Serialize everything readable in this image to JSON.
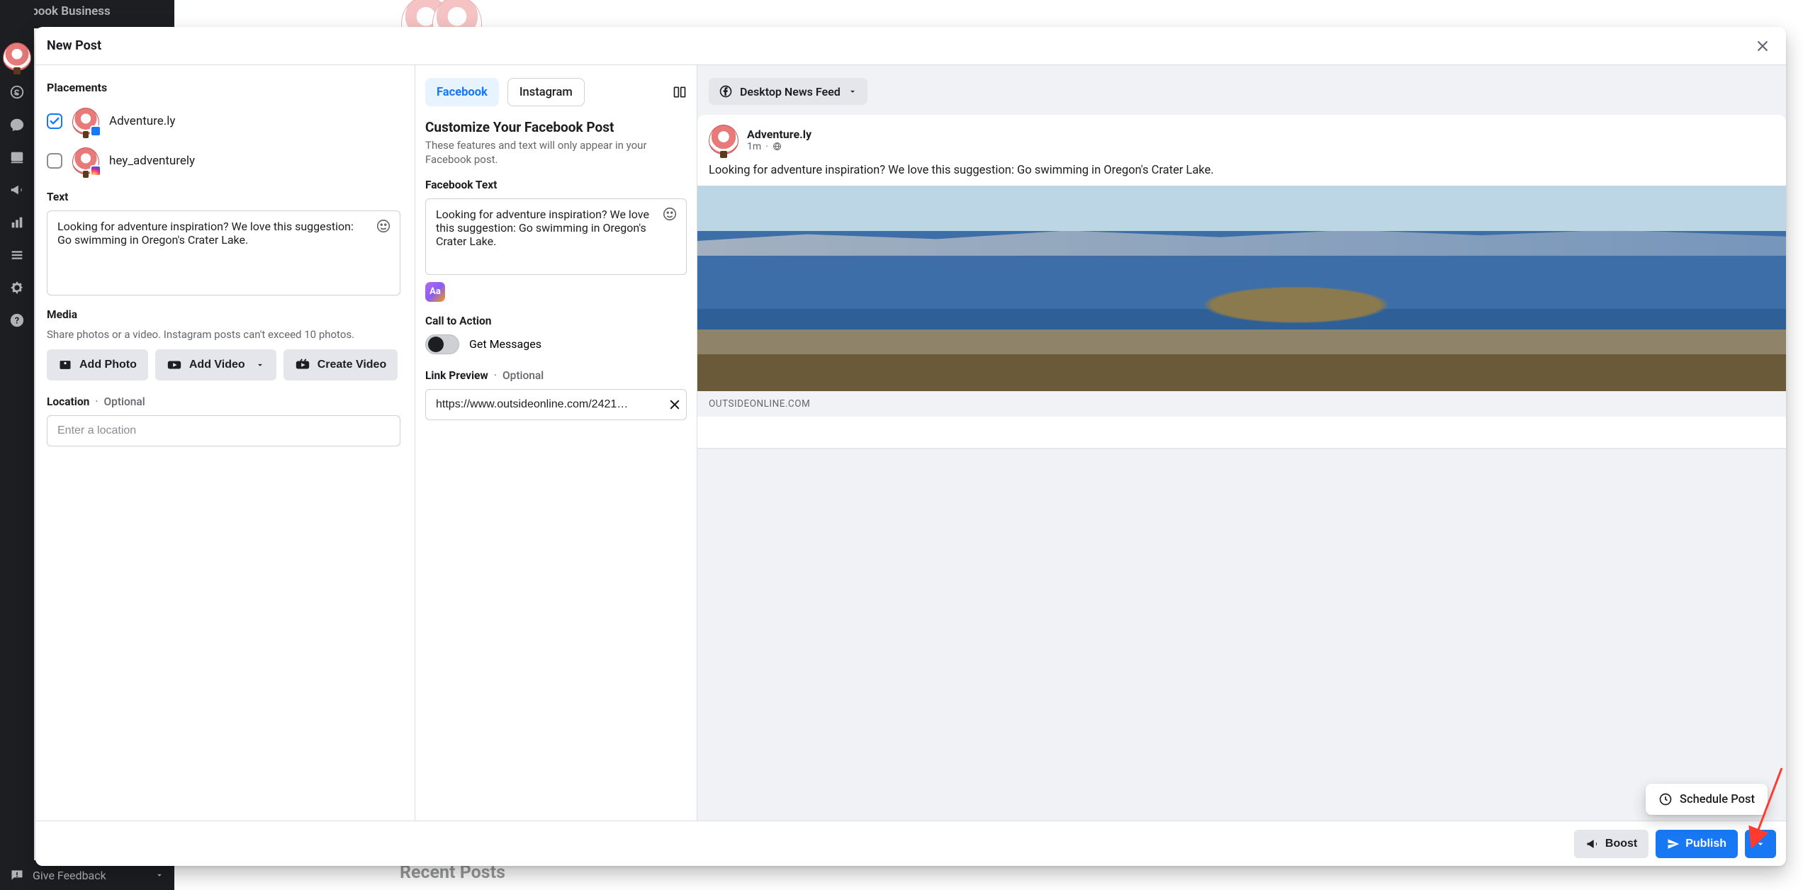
{
  "brand": "Facebook Business",
  "feedback_label": "Give Feedback",
  "recent_posts_label": "Recent Posts",
  "modal": {
    "title": "New Post",
    "placements": {
      "title": "Placements",
      "items": [
        {
          "name": "Adventure.ly",
          "checked": true,
          "network": "facebook"
        },
        {
          "name": "hey_adventurely",
          "checked": false,
          "network": "instagram"
        }
      ]
    },
    "text_section": {
      "label": "Text",
      "value": "Looking for adventure inspiration? We love this suggestion: Go swimming in Oregon's Crater Lake."
    },
    "media": {
      "label": "Media",
      "hint": "Share photos or a video. Instagram posts can't exceed 10 photos.",
      "add_photo": "Add Photo",
      "add_video": "Add Video",
      "create_video": "Create Video"
    },
    "location": {
      "label": "Location",
      "optional": "Optional",
      "placeholder": "Enter a location"
    },
    "customize": {
      "tabs": {
        "facebook": "Facebook",
        "instagram": "Instagram"
      },
      "heading": "Customize Your Facebook Post",
      "hint": "These features and text will only appear in your Facebook post.",
      "fb_text_label": "Facebook Text",
      "fb_text_value": "Looking for adventure inspiration? We love this suggestion: Go swimming in Oregon's Crater Lake.",
      "cta_label": "Call to Action",
      "cta_option": "Get Messages",
      "link_label": "Link Preview",
      "link_optional": "Optional",
      "link_value": "https://www.outsideonline.com/2421…"
    },
    "preview": {
      "selector": "Desktop News Feed",
      "page_name": "Adventure.ly",
      "meta": "1m",
      "body": "Looking for adventure inspiration? We love this suggestion: Go swimming in Oregon's Crater Lake.",
      "domain": "OUTSIDEONLINE.COM"
    },
    "footer": {
      "boost": "Boost",
      "publish": "Publish",
      "schedule": "Schedule Post"
    }
  }
}
